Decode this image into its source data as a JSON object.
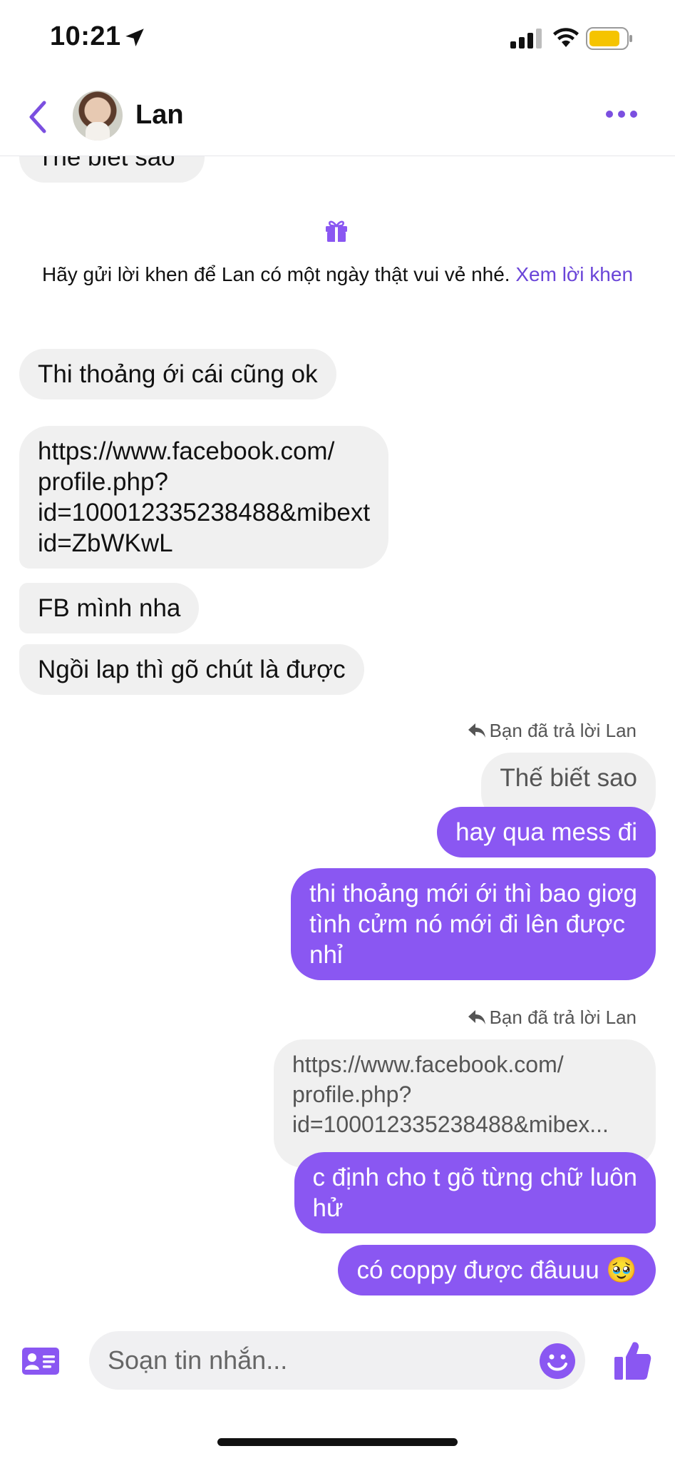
{
  "status_bar": {
    "time": "10:21"
  },
  "header": {
    "contact_name": "Lan"
  },
  "chat": {
    "partial_top_message": "Thế biết sao",
    "compliment_notice": {
      "text": "Hãy gửi lời khen để Lan có một ngày thật vui vẻ nhé.",
      "link": "Xem lời khen"
    },
    "incoming": [
      "Thi thoảng ới cái cũng ok",
      "https://www.facebook.com/\nprofile.php?\nid=100012335238488&mibext\nid=ZbWKwL",
      "FB mình nha",
      "Ngồi lap thì gõ chút là được"
    ],
    "reply_group_1": {
      "label": "Bạn đã trả lời Lan",
      "quoted": "Thế biết sao",
      "messages": [
        "hay qua mess đi",
        "thi thoảng mới ới thì bao giơg\ntình cửm nó mới đi lên được\nnhỉ"
      ]
    },
    "reply_group_2": {
      "label": "Bạn đã trả lời Lan",
      "quoted": "https://www.facebook.com/\nprofile.php?\nid=100012335238488&mibex...",
      "messages": [
        "c định cho t gõ từng chữ luôn\nhử",
        "có coppy được đâuuu 🥹"
      ]
    }
  },
  "composer": {
    "placeholder": "Soạn tin nhắn..."
  },
  "colors": {
    "accent": "#8a57f2",
    "incoming_bubble": "#f0f0f0"
  }
}
